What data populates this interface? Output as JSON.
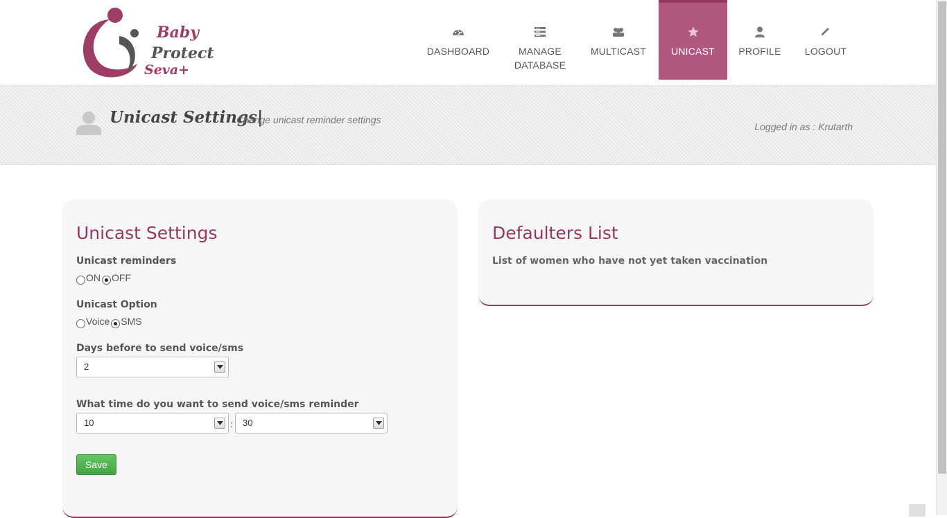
{
  "brand": {
    "line1": "Baby",
    "line2": "Protect",
    "line3": "Seva+"
  },
  "nav": [
    {
      "label1": "DASHBOARD",
      "label2": "",
      "icon": "dashboard-icon"
    },
    {
      "label1": "MANAGE",
      "label2": "DATABASE",
      "icon": "database-icon"
    },
    {
      "label1": "MULTICAST",
      "label2": "",
      "icon": "group-icon"
    },
    {
      "label1": "UNICAST",
      "label2": "",
      "icon": "star-icon",
      "active": true
    },
    {
      "label1": "PROFILE",
      "label2": "",
      "icon": "user-icon"
    },
    {
      "label1": "LOGOUT",
      "label2": "",
      "icon": "pencil-icon"
    }
  ],
  "header": {
    "title": "Unicast Settings|",
    "subtitle": "Change unicast reminder settings",
    "logged_in": "Logged in as : Krutarth"
  },
  "settings": {
    "heading": "Unicast Settings",
    "reminders_label": "Unicast reminders",
    "reminders_on": "ON",
    "reminders_off": "OFF",
    "reminders_selected": "OFF",
    "option_label": "Unicast Option",
    "option_voice": "Voice",
    "option_sms": "SMS",
    "option_selected": "SMS",
    "days_label": "Days before to send voice/sms",
    "days_value": "2",
    "time_label": "What time do you want to send voice/sms reminder",
    "hour_value": "10",
    "minute_value": "30",
    "time_separator": ":",
    "save_label": "Save"
  },
  "defaulters": {
    "heading": "Defaulters List",
    "description": "List of women who have not yet taken vaccination"
  },
  "colors": {
    "accent": "#96375f",
    "nav_active": "#b2587e",
    "save_green": "#4cae4c"
  }
}
